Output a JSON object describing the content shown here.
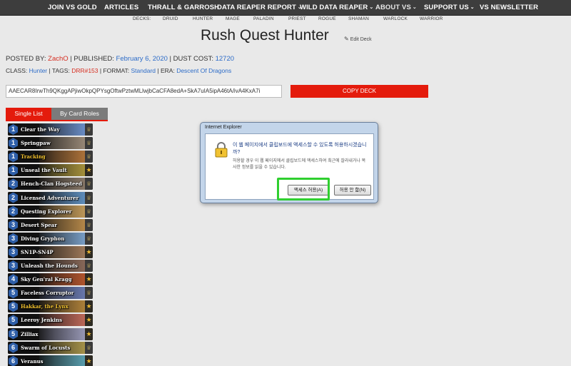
{
  "nav": {
    "items": [
      {
        "label": "JOIN VS GOLD",
        "dropdown": false
      },
      {
        "label": "ARTICLES",
        "dropdown": false
      },
      {
        "label": "THRALL & GARROSH",
        "dropdown": false
      },
      {
        "label": "DATA REAPER REPORT",
        "dropdown": true
      },
      {
        "label": "WILD DATA REAPER",
        "dropdown": true
      },
      {
        "label": "ABOUT VS",
        "dropdown": true
      },
      {
        "label": "SUPPORT US",
        "dropdown": true
      },
      {
        "label": "VS NEWSLETTER",
        "dropdown": false
      }
    ],
    "chevron": "⌄",
    "sub_items": [
      "DECKS:",
      "DRUID",
      "HUNTER",
      "MAGE",
      "PALADIN",
      "PRIEST",
      "ROGUE",
      "SHAMAN",
      "WARLOCK",
      "WARRIOR"
    ]
  },
  "page": {
    "title": "Rush Quest Hunter",
    "edit_label": "Edit Deck",
    "meta": {
      "posted_by_label": "POSTED BY:",
      "author": "ZachO",
      "published_label": "| PUBLISHED:",
      "date": "February 6, 2020",
      "dust_label": "| DUST COST:",
      "dust": "12720",
      "class_label": "CLASS:",
      "class": "Hunter",
      "tags_label": "| TAGS:",
      "tag": "DRR#153",
      "format_label": "| FORMAT:",
      "format": "Standard",
      "era_label": "| ERA:",
      "era": "Descent Of Dragons"
    },
    "deck_code": "AAECAR8IrwTh9QKggAPjiwOkpQPYsgOftwPztwMLlwjbCaCFA8edA+SkA7uIA5ipA46tA/ivA4KxA7i",
    "copy_button": "COPY DECK",
    "tabs": [
      "Single List",
      "By Card Roles"
    ]
  },
  "cards": [
    {
      "cost": "1",
      "name": "Clear the Way",
      "gold": false,
      "rarity": "crown",
      "color": "#6b8fc9"
    },
    {
      "cost": "1",
      "name": "Springpaw",
      "gold": false,
      "rarity": "crown",
      "color": "#9a8a78"
    },
    {
      "cost": "1",
      "name": "Tracking",
      "gold": true,
      "rarity": "crown",
      "color": "#b0743a"
    },
    {
      "cost": "1",
      "name": "Unseal the Vault",
      "gold": false,
      "rarity": "star",
      "color": "#a8933c"
    },
    {
      "cost": "2",
      "name": "Hench-Clan Hogsteed",
      "gold": false,
      "rarity": "crown",
      "color": "#8a7a6a"
    },
    {
      "cost": "2",
      "name": "Licensed Adventurer",
      "gold": false,
      "rarity": "crown",
      "color": "#5f8fbf"
    },
    {
      "cost": "2",
      "name": "Questing Explorer",
      "gold": false,
      "rarity": "crown",
      "color": "#c29a5a"
    },
    {
      "cost": "3",
      "name": "Desert Spear",
      "gold": false,
      "rarity": "crown",
      "color": "#b88a4a"
    },
    {
      "cost": "3",
      "name": "Diving Gryphon",
      "gold": false,
      "rarity": "crown",
      "color": "#7aa0c8"
    },
    {
      "cost": "3",
      "name": "SN1P-SN4P",
      "gold": false,
      "rarity": "star",
      "color": "#a07a5a"
    },
    {
      "cost": "3",
      "name": "Unleash the Hounds",
      "gold": false,
      "rarity": "crown",
      "color": "#8a6a5a"
    },
    {
      "cost": "4",
      "name": "Sky Gen'ral Kragg",
      "gold": false,
      "rarity": "star",
      "color": "#b4562e"
    },
    {
      "cost": "5",
      "name": "Faceless Corruptor",
      "gold": false,
      "rarity": "crown",
      "color": "#6a7ab0"
    },
    {
      "cost": "5",
      "name": "Hakkar, the Lynx",
      "gold": true,
      "rarity": "star",
      "color": "#b0823a"
    },
    {
      "cost": "5",
      "name": "Leeroy Jenkins",
      "gold": false,
      "rarity": "star",
      "color": "#c06a5a"
    },
    {
      "cost": "5",
      "name": "Zilliax",
      "gold": false,
      "rarity": "star",
      "color": "#9a9ab8"
    },
    {
      "cost": "6",
      "name": "Swarm of Locusts",
      "gold": false,
      "rarity": "crown",
      "color": "#a8944a"
    },
    {
      "cost": "6",
      "name": "Veranus",
      "gold": false,
      "rarity": "star",
      "color": "#5aa0b0"
    }
  ],
  "dialog": {
    "title": "Internet Explorer",
    "question": "이 웹 페이지에서 클립보드에 액세스할 수 있도록 허용하시겠습니까?",
    "description": "허용할 경우 이 웹 페이지에서 클립보드에 액세스하여 최근에 잘라내거나 복사한 정보를 읽을 수 있습니다.",
    "allow_button": "액세스 허용(A)",
    "deny_button": "허용 안 함(N)"
  },
  "colors": {
    "nav_bg": "#3d3d3d",
    "accent_red": "#e41b0c",
    "link_blue": "#2d6cc8",
    "highlight_green": "#2fcf2f"
  }
}
